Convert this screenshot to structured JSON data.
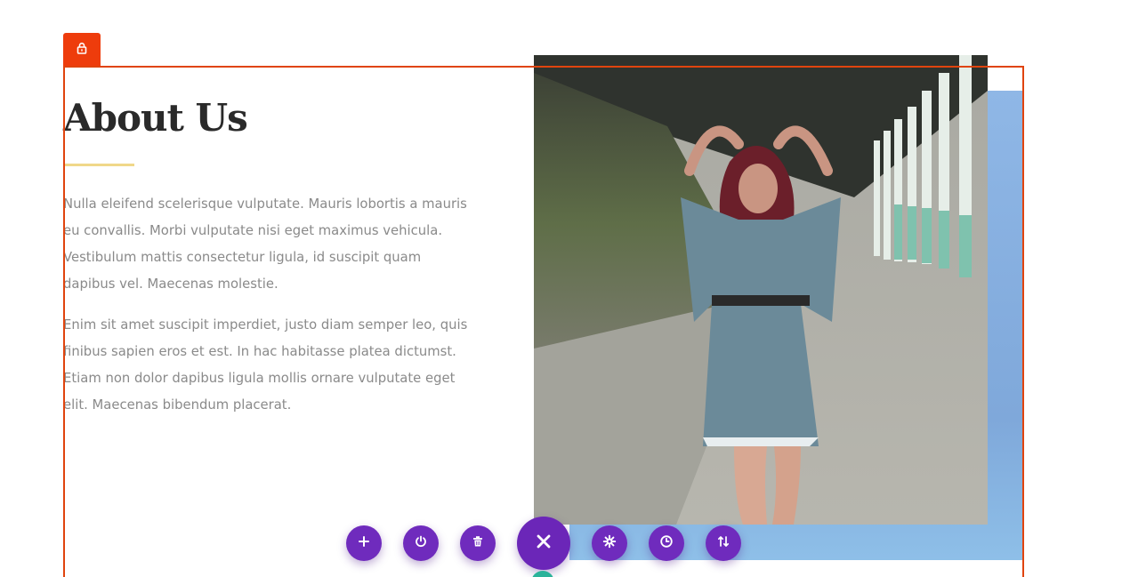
{
  "section": {
    "lock_icon": "lock-icon",
    "outline_color": "#e0440e"
  },
  "content": {
    "title": "About Us",
    "paragraphs": [
      "Nulla eleifend scelerisque vulputate. Mauris lobortis a mauris eu convallis. Morbi vulputate nisi eget maximus vehicula. Vestibulum mattis consectetur ligula, id suscipit quam dapibus vel. Maecenas molestie.",
      "Enim sit amet suscipit imperdiet, justo diam semper leo, quis finibus sapien eros et est. In hac habitasse platea dictumst. Etiam non dolor dapibus ligula mollis ornare vulputate eget elit. Maecenas bibendum placerat."
    ]
  },
  "image": {
    "subject": "woman-in-embroidered-tunic-under-colonnade"
  },
  "toolbar": {
    "accent": "#6f2bbd",
    "buttons": [
      {
        "icon": "plus-icon"
      },
      {
        "icon": "power-icon"
      },
      {
        "icon": "trash-icon"
      },
      {
        "icon": "close-icon"
      },
      {
        "icon": "gear-icon"
      },
      {
        "icon": "history-icon"
      },
      {
        "icon": "sort-icon"
      }
    ]
  }
}
